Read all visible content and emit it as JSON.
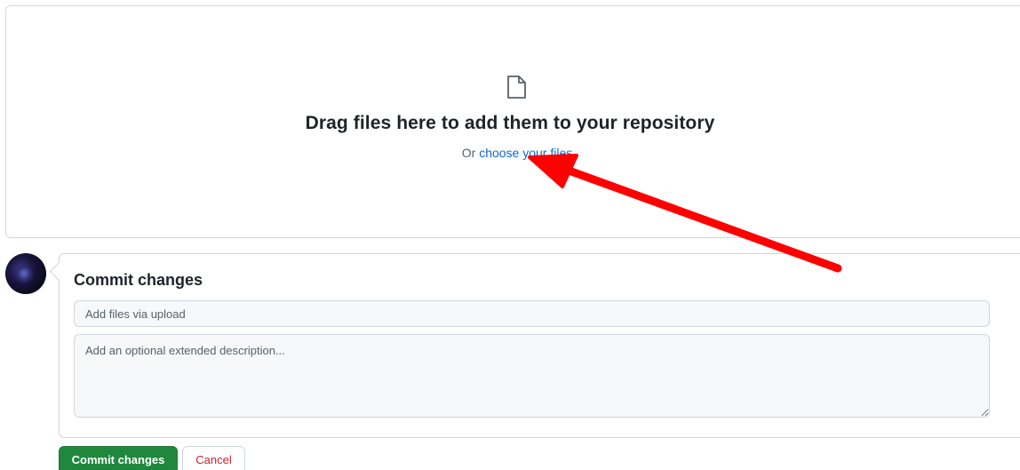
{
  "dropzone": {
    "icon": "file-icon",
    "title": "Drag files here to add them to your repository",
    "prefix": "Or",
    "link": "choose your files"
  },
  "commit": {
    "avatar_icon": "user-avatar",
    "title": "Commit changes",
    "summary_placeholder": "Add files via upload",
    "description_placeholder": "Add an optional extended description..."
  },
  "buttons": {
    "commit_label": "Commit changes",
    "cancel_label": "Cancel"
  },
  "colors": {
    "link": "#0969da",
    "commit_button": "#1f883d",
    "cancel_text": "#cf222e",
    "annotation_arrow": "#ff0000"
  }
}
